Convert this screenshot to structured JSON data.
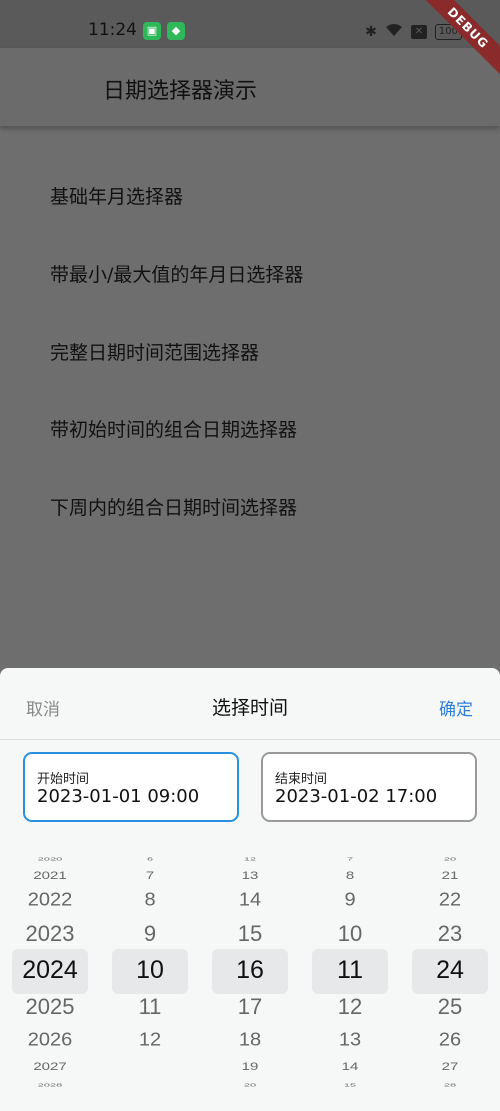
{
  "status_bar": {
    "time": "11:24",
    "battery": "100"
  },
  "debug_banner": "DEBUG",
  "app_bar": {
    "title": "日期选择器演示"
  },
  "menu": [
    "基础年月选择器",
    "带最小/最大值的年月日选择器",
    "完整日期时间范围选择器",
    "带初始时间的组合日期选择器",
    "下周内的组合日期时间选择器"
  ],
  "sheet": {
    "cancel": "取消",
    "title": "选择时间",
    "confirm": "确定",
    "start": {
      "label": "开始时间",
      "value": "2023-01-01 09:00"
    },
    "end": {
      "label": "结束时间",
      "value": "2023-01-02 17:00"
    }
  },
  "wheels": {
    "year": [
      "2020",
      "2021",
      "2022",
      "2023",
      "2024",
      "2025",
      "2026",
      "2027",
      "2028"
    ],
    "month": [
      "6",
      "7",
      "8",
      "9",
      "10",
      "11",
      "12",
      "",
      ""
    ],
    "day": [
      "12",
      "13",
      "14",
      "15",
      "16",
      "17",
      "18",
      "19",
      "20"
    ],
    "hour": [
      "7",
      "8",
      "9",
      "10",
      "11",
      "12",
      "13",
      "14",
      "15"
    ],
    "minute": [
      "20",
      "21",
      "22",
      "23",
      "24",
      "25",
      "26",
      "27",
      "28"
    ]
  },
  "colors": {
    "accent": "#2f7ed8",
    "start_border": "#2a8fde",
    "end_border": "#9a9a9a"
  }
}
